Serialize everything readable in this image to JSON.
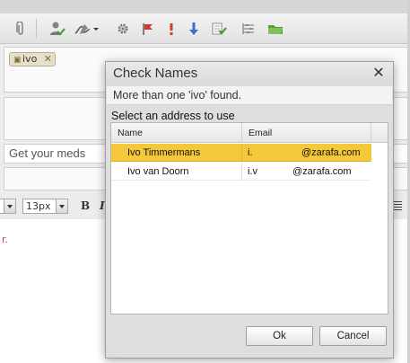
{
  "composer": {
    "recipient_chip": "ivo",
    "subject": "Get your meds",
    "font_size": "13px"
  },
  "dialog": {
    "title": "Check Names",
    "message": "More than one 'ivo' found.",
    "prompt": "Select an address to use",
    "columns": {
      "name": "Name",
      "email": "Email"
    },
    "rows": [
      {
        "name": "Ivo Timmermans",
        "email_prefix": "i.",
        "email_domain": "@zarafa.com",
        "selected": true
      },
      {
        "name": "Ivo van Doorn",
        "email_prefix": "i.v",
        "email_domain": "@zarafa.com",
        "selected": false
      }
    ],
    "ok_label": "Ok",
    "cancel_label": "Cancel"
  },
  "colors": {
    "selection": "#f5c83a",
    "dialog_bg": "#dedede"
  },
  "icons": [
    "paperclip-icon",
    "check-user-icon",
    "signature-icon",
    "settings-icon",
    "flag-icon",
    "high-priority-icon",
    "low-priority-icon",
    "read-receipt-icon",
    "delivery-options-icon",
    "folder-icon",
    "close-icon"
  ]
}
